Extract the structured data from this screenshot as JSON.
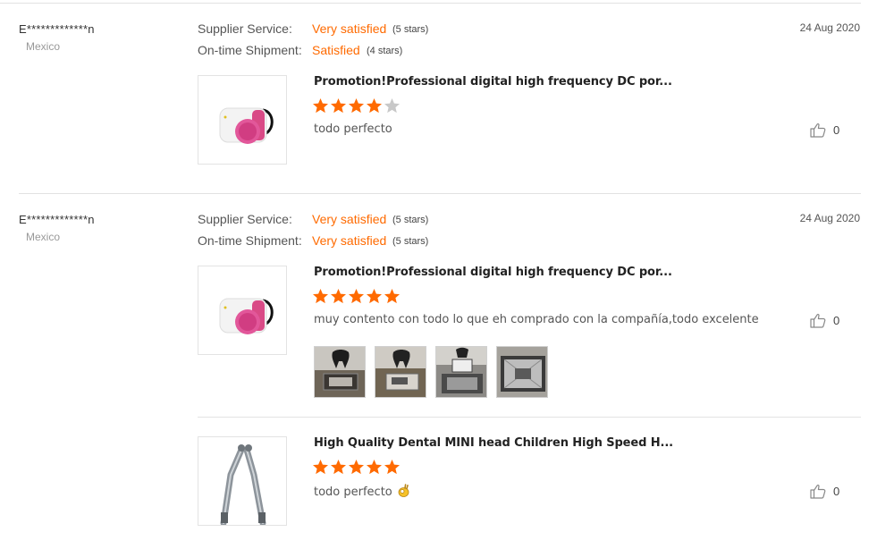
{
  "reviews": [
    {
      "reviewer": "E*************n",
      "country": "Mexico",
      "date": "24 Aug 2020",
      "supplier_service": {
        "label": "Supplier Service:",
        "value": "Very satisfied",
        "stars_text": "(5 stars)"
      },
      "shipment": {
        "label": "On-time Shipment:",
        "value": "Satisfied",
        "stars_text": "(4 stars)"
      },
      "products": [
        {
          "title": "Promotion!Professional digital high frequency DC por...",
          "rating": 4,
          "comment": "todo perfecto",
          "likes": "0"
        }
      ]
    },
    {
      "reviewer": "E*************n",
      "country": "Mexico",
      "date": "24 Aug 2020",
      "supplier_service": {
        "label": "Supplier Service:",
        "value": "Very satisfied",
        "stars_text": "(5 stars)"
      },
      "shipment": {
        "label": "On-time Shipment:",
        "value": "Very satisfied",
        "stars_text": "(5 stars)"
      },
      "products": [
        {
          "title": "Promotion!Professional digital high frequency DC por...",
          "rating": 5,
          "comment": "muy contento con todo lo que eh comprado con la compañía,todo excelente",
          "likes": "0",
          "photos": 4
        },
        {
          "title": "High Quality Dental MINI head Children High Speed H...",
          "rating": 5,
          "comment": "todo perfecto",
          "comment_emoji": "ok-hand-emoji",
          "likes": "0"
        }
      ]
    }
  ],
  "colors": {
    "accent": "#ff6a00",
    "star_off": "#c8c8c8",
    "divider": "#e2e2e2"
  },
  "icons": {
    "like": "thumbs-up-icon",
    "star": "star-icon"
  }
}
